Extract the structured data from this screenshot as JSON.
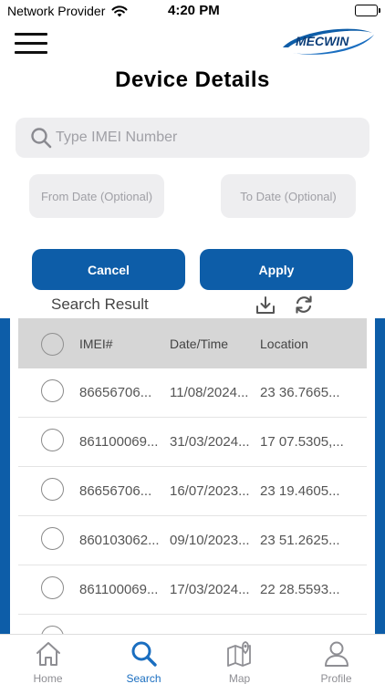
{
  "status_bar": {
    "carrier": "Network Provider",
    "time": "4:20 PM"
  },
  "header": {
    "logo_text": "MECWIN",
    "title": "Device Details"
  },
  "search": {
    "placeholder": "Type IMEI Number",
    "value": ""
  },
  "filters": {
    "from_date": "From Date (Optional)",
    "to_date": "To Date (Optional)"
  },
  "actions": {
    "cancel_label": "Cancel",
    "apply_label": "Apply"
  },
  "results": {
    "header": "Search Result",
    "columns": [
      "IMEI#",
      "Date/Time",
      "Location"
    ],
    "rows": [
      {
        "imei": "86656706...",
        "date": "11/08/2024...",
        "location": "23 36.7665..."
      },
      {
        "imei": "861100069...",
        "date": "31/03/2024...",
        "location": "17 07.5305,..."
      },
      {
        "imei": "86656706...",
        "date": "16/07/2023...",
        "location": "23 19.4605..."
      },
      {
        "imei": "860103062...",
        "date": "09/10/2023...",
        "location": "23 51.2625..."
      },
      {
        "imei": "861100069...",
        "date": "17/03/2024...",
        "location": "22 28.5593..."
      },
      {
        "imei": "",
        "date": "",
        "location": ""
      }
    ]
  },
  "tabs": [
    {
      "label": "Home",
      "icon": "home-icon",
      "active": false
    },
    {
      "label": "Search",
      "icon": "search-icon",
      "active": true
    },
    {
      "label": "Map",
      "icon": "map-icon",
      "active": false
    },
    {
      "label": "Profile",
      "icon": "profile-icon",
      "active": false
    }
  ],
  "colors": {
    "primary": "#0d5da8",
    "active_tab": "#1a6ec0",
    "inactive_tab": "#8e8e93",
    "field_bg": "#eeeef0",
    "table_header_bg": "#d6d6d6"
  }
}
